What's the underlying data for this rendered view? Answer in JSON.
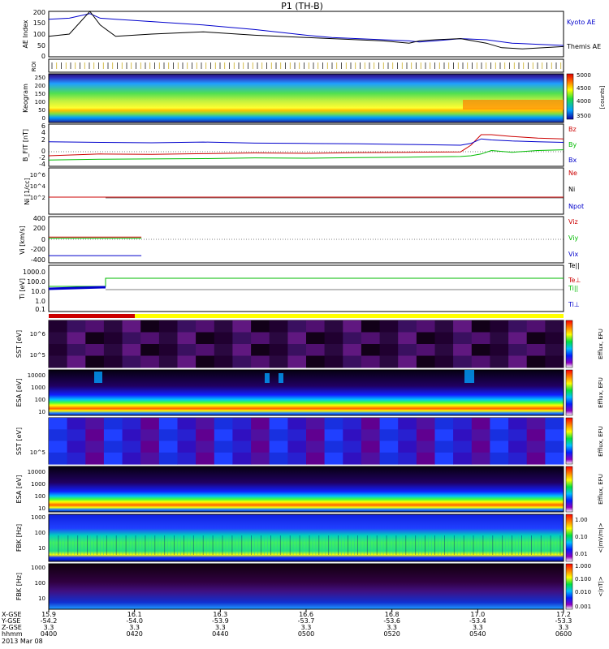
{
  "title": "P1 (TH-B)",
  "date_label": "2013 Mar 08",
  "colors": {
    "blue": "#0000cc",
    "red": "#cc0000",
    "green": "#00bb00",
    "black": "#000000",
    "yellow": "#ffff00"
  },
  "chart_data": [
    {
      "panel": "ae",
      "type": "line",
      "ylabel": "AE Index",
      "yticks": [
        "0",
        "50",
        "100",
        "150",
        "200"
      ],
      "ylim": [
        0,
        200
      ],
      "series": [
        {
          "name": "Kyoto AE",
          "color": "#0000cc",
          "x": [
            0,
            0.04,
            0.08,
            0.1,
            0.13,
            0.2,
            0.3,
            0.4,
            0.5,
            0.55,
            0.6,
            0.65,
            0.7,
            0.72,
            0.75,
            0.8,
            0.85,
            0.9,
            0.95,
            1.0
          ],
          "y": [
            165,
            170,
            190,
            170,
            165,
            155,
            140,
            120,
            95,
            85,
            80,
            75,
            70,
            65,
            70,
            80,
            75,
            60,
            55,
            50
          ]
        },
        {
          "name": "Themis AE",
          "color": "#000000",
          "x": [
            0,
            0.04,
            0.08,
            0.1,
            0.13,
            0.2,
            0.3,
            0.4,
            0.5,
            0.55,
            0.6,
            0.65,
            0.7,
            0.72,
            0.75,
            0.8,
            0.85,
            0.88,
            0.92,
            1.0
          ],
          "y": [
            90,
            100,
            200,
            140,
            90,
            100,
            110,
            95,
            85,
            80,
            75,
            70,
            60,
            70,
            75,
            80,
            60,
            40,
            35,
            45
          ]
        }
      ]
    },
    {
      "panel": "roi",
      "type": "table",
      "ylabel": "ROI"
    },
    {
      "panel": "keogram",
      "type": "heatmap",
      "ylabel": "Keogram",
      "yticks": [
        "0",
        "50",
        "100",
        "150",
        "200",
        "250"
      ],
      "colorbar": {
        "ticks": [
          "5000",
          "4500",
          "4000",
          "3500"
        ],
        "label": "[counts]"
      }
    },
    {
      "panel": "bfield",
      "type": "line",
      "ylabel": "B_FIT [nT]",
      "yticks": [
        "-4",
        "-2",
        "0",
        "2",
        "4",
        "6"
      ],
      "ylim": [
        -5,
        7
      ],
      "series": [
        {
          "name": "Bz",
          "color": "#cc0000",
          "x": [
            0,
            0.1,
            0.2,
            0.3,
            0.4,
            0.5,
            0.6,
            0.7,
            0.8,
            0.82,
            0.84,
            0.86,
            0.9,
            0.95,
            1.0
          ],
          "y": [
            -2,
            -1.5,
            -1.6,
            -1.4,
            -1.2,
            -1.3,
            -1.1,
            -1.0,
            -0.9,
            1,
            4,
            4,
            3.5,
            3,
            2.8
          ]
        },
        {
          "name": "By",
          "color": "#00bb00",
          "x": [
            0,
            0.1,
            0.2,
            0.3,
            0.4,
            0.5,
            0.6,
            0.7,
            0.8,
            0.82,
            0.84,
            0.86,
            0.9,
            0.95,
            1.0
          ],
          "y": [
            -3.2,
            -3,
            -2.9,
            -2.8,
            -2.6,
            -2.7,
            -2.5,
            -2.4,
            -2.2,
            -2,
            -1.5,
            -0.5,
            -1,
            -0.5,
            -0.3
          ]
        },
        {
          "name": "Bx",
          "color": "#0000cc",
          "x": [
            0,
            0.1,
            0.2,
            0.3,
            0.4,
            0.5,
            0.6,
            0.7,
            0.8,
            0.82,
            0.84,
            0.86,
            0.9,
            0.95,
            1.0
          ],
          "y": [
            2,
            1.8,
            1.7,
            1.9,
            1.6,
            1.5,
            1.4,
            1.2,
            1,
            1.5,
            2.8,
            2.5,
            2.2,
            2,
            1.8
          ]
        }
      ]
    },
    {
      "panel": "density",
      "type": "line",
      "ylabel": "Ni [1/cc]",
      "yticks": [
        "10^6",
        "10^4",
        "10^2"
      ],
      "legend": [
        "Ne",
        "Ni",
        "Npot"
      ],
      "legend_colors": [
        "#cc0000",
        "#000000",
        "#0000cc"
      ]
    },
    {
      "panel": "velocity",
      "type": "line",
      "ylabel": "Vi [km/s]",
      "yticks": [
        "400",
        "200",
        "0",
        "-200",
        "-400"
      ],
      "ylim": [
        -450,
        450
      ],
      "legend": [
        "Viz",
        "Viy",
        "Vix"
      ],
      "legend_colors": [
        "#cc0000",
        "#00bb00",
        "#0000cc"
      ],
      "series": [
        {
          "name": "Viz",
          "color": "#cc0000",
          "x": [
            0,
            0.18
          ],
          "y": [
            50,
            50
          ]
        },
        {
          "name": "Viy",
          "color": "#00bb00",
          "x": [
            0,
            0.18
          ],
          "y": [
            30,
            30
          ]
        },
        {
          "name": "Vix",
          "color": "#0000cc",
          "x": [
            0,
            0.18
          ],
          "y": [
            -310,
            -310
          ]
        }
      ]
    },
    {
      "panel": "temperature",
      "type": "line",
      "ylabel": "Ti [eV]",
      "yticks": [
        "1000.0",
        "100.0",
        "10.0",
        "1.0",
        "0.1"
      ],
      "legend": [
        "Te||",
        "Te⊥",
        "Ti||",
        "Ti⊥"
      ],
      "legend_colors": [
        "#000000",
        "#cc0000",
        "#00bb00",
        "#0000cc"
      ]
    },
    {
      "panel": "sst1",
      "type": "heatmap",
      "ylabel": "SST [eV]",
      "yticks": [
        "10^6",
        "10^5"
      ],
      "cbar_label": "Efflux, EFU"
    },
    {
      "panel": "esa1",
      "type": "heatmap",
      "ylabel": "ESA [eV]",
      "yticks": [
        "10000",
        "1000",
        "100",
        "10"
      ],
      "cbar_label": "Efflux, EFU"
    },
    {
      "panel": "sst2",
      "type": "heatmap",
      "ylabel": "SST [eV]",
      "yticks": [
        "10^5"
      ],
      "cbar_label": "Efflux, EFU"
    },
    {
      "panel": "esa2",
      "type": "heatmap",
      "ylabel": "ESA [eV]",
      "yticks": [
        "10000",
        "1000",
        "100",
        "10"
      ],
      "cbar_label": "Efflux, EFU"
    },
    {
      "panel": "fbk1",
      "type": "heatmap",
      "ylabel": "FBK [Hz]",
      "yticks": [
        "1000",
        "100",
        "10"
      ],
      "colorbar": {
        "ticks": [
          "1.00",
          "0.10",
          "0.01"
        ],
        "label": "<|mV/m|>"
      }
    },
    {
      "panel": "fbk2",
      "type": "heatmap",
      "ylabel": "FBK [Hz]",
      "yticks": [
        "1000",
        "100",
        "10"
      ],
      "colorbar": {
        "ticks": [
          "1.000",
          "0.100",
          "0.010",
          "0.001"
        ],
        "label": "<|nT|>"
      }
    }
  ],
  "ephemeris": {
    "row_labels": [
      "X-GSE",
      "Y-GSE",
      "Z-GSE",
      "hhmm"
    ],
    "columns": [
      {
        "x": "15.9",
        "y": "-54.2",
        "z": "3.3",
        "t": "0400"
      },
      {
        "x": "16.1",
        "y": "-54.0",
        "z": "3.3",
        "t": "0420"
      },
      {
        "x": "16.3",
        "y": "-53.9",
        "z": "3.3",
        "t": "0440"
      },
      {
        "x": "16.6",
        "y": "-53.7",
        "z": "3.3",
        "t": "0500"
      },
      {
        "x": "16.8",
        "y": "-53.6",
        "z": "3.3",
        "t": "0520"
      },
      {
        "x": "17.0",
        "y": "-53.4",
        "z": "3.3",
        "t": "0540"
      },
      {
        "x": "17.2",
        "y": "-53.3",
        "z": "3.3",
        "t": "0600"
      }
    ]
  }
}
